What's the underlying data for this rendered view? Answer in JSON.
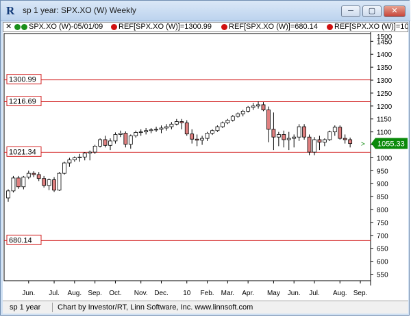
{
  "window": {
    "title": "sp 1 year: SPX.XO (W) Weekly",
    "app_icon": "investor-rt-icon",
    "buttons": {
      "minimize": "─",
      "maximize": "▢",
      "close": "✕"
    }
  },
  "legend": {
    "close_glyph": "✕",
    "items": [
      {
        "label": "SPX.XO (W)-05/01/09",
        "dot_color": "#1a8f1a",
        "dot_color2": "#1a8f1a"
      },
      {
        "label": "REF[SPX.XO (W)]=1300.99",
        "dot_color": "#d01010"
      },
      {
        "label": "REF[SPX.XO (W)]=680.14",
        "dot_color": "#d01010"
      },
      {
        "label": "REF[SPX.XO (W)]=10",
        "dot_color": "#d01010"
      }
    ]
  },
  "status": {
    "left": "sp 1 year",
    "right": "Chart by Investor/RT, Linn Software, Inc. www.linnsoft.com"
  },
  "chart_data": {
    "type": "candlestick",
    "symbol": "SPX.XO (W) Weekly",
    "ylim": [
      525,
      1480
    ],
    "y_ticks": [
      550,
      600,
      650,
      700,
      750,
      800,
      850,
      900,
      950,
      1000,
      1050,
      1100,
      1150,
      1200,
      1250,
      1300,
      1350,
      1400,
      1450
    ],
    "extra_tick": "1500",
    "x_labels": [
      "Jun.",
      "Jul.",
      "Aug.",
      "Sep.",
      "Oct.",
      "Nov.",
      "Dec.",
      "10",
      "Feb.",
      "Mar.",
      "Apr.",
      "May",
      "Jun.",
      "Jul.",
      "Aug.",
      "Sep."
    ],
    "x_label_weeks": [
      4,
      9,
      13,
      17,
      21,
      26,
      30,
      35,
      39,
      43,
      47,
      52,
      56,
      60,
      65,
      69
    ],
    "ref_lines": [
      {
        "label": "1300.99",
        "value": 1300.99,
        "color": "#d22020"
      },
      {
        "label": "1216.69",
        "value": 1216.69,
        "color": "#d22020"
      },
      {
        "label": "1021.34",
        "value": 1021.34,
        "color": "#d22020"
      },
      {
        "label": "680.14",
        "value": 680.14,
        "color": "#d22020"
      }
    ],
    "last_price": {
      "label": "1055.33",
      "value": 1055.33,
      "color": "#0b8a0b"
    },
    "up_color": "#ffffff",
    "down_color": "#e08080",
    "candles": [
      {
        "o": 845,
        "h": 878,
        "l": 830,
        "c": 872
      },
      {
        "o": 872,
        "h": 930,
        "l": 866,
        "c": 922
      },
      {
        "o": 922,
        "h": 930,
        "l": 880,
        "c": 888
      },
      {
        "o": 888,
        "h": 930,
        "l": 878,
        "c": 925
      },
      {
        "o": 925,
        "h": 950,
        "l": 918,
        "c": 940
      },
      {
        "o": 940,
        "h": 948,
        "l": 925,
        "c": 935
      },
      {
        "o": 935,
        "h": 945,
        "l": 910,
        "c": 920
      },
      {
        "o": 920,
        "h": 930,
        "l": 885,
        "c": 893
      },
      {
        "o": 893,
        "h": 920,
        "l": 875,
        "c": 915
      },
      {
        "o": 915,
        "h": 925,
        "l": 868,
        "c": 875
      },
      {
        "o": 875,
        "h": 945,
        "l": 872,
        "c": 940
      },
      {
        "o": 940,
        "h": 985,
        "l": 935,
        "c": 980
      },
      {
        "o": 980,
        "h": 1000,
        "l": 965,
        "c": 992
      },
      {
        "o": 992,
        "h": 1005,
        "l": 985,
        "c": 1000
      },
      {
        "o": 1000,
        "h": 1015,
        "l": 985,
        "c": 1003
      },
      {
        "o": 1003,
        "h": 1022,
        "l": 990,
        "c": 1018
      },
      {
        "o": 1018,
        "h": 1028,
        "l": 990,
        "c": 1022
      },
      {
        "o": 1022,
        "h": 1050,
        "l": 1015,
        "c": 1045
      },
      {
        "o": 1045,
        "h": 1075,
        "l": 1040,
        "c": 1070
      },
      {
        "o": 1070,
        "h": 1085,
        "l": 1040,
        "c": 1048
      },
      {
        "o": 1048,
        "h": 1075,
        "l": 1030,
        "c": 1065
      },
      {
        "o": 1065,
        "h": 1098,
        "l": 1055,
        "c": 1090
      },
      {
        "o": 1090,
        "h": 1105,
        "l": 1080,
        "c": 1095
      },
      {
        "o": 1095,
        "h": 1102,
        "l": 1040,
        "c": 1052
      },
      {
        "o": 1052,
        "h": 1090,
        "l": 1035,
        "c": 1085
      },
      {
        "o": 1085,
        "h": 1105,
        "l": 1078,
        "c": 1098
      },
      {
        "o": 1098,
        "h": 1110,
        "l": 1085,
        "c": 1100
      },
      {
        "o": 1100,
        "h": 1115,
        "l": 1090,
        "c": 1105
      },
      {
        "o": 1105,
        "h": 1115,
        "l": 1095,
        "c": 1108
      },
      {
        "o": 1108,
        "h": 1120,
        "l": 1100,
        "c": 1110
      },
      {
        "o": 1110,
        "h": 1125,
        "l": 1095,
        "c": 1115
      },
      {
        "o": 1115,
        "h": 1130,
        "l": 1105,
        "c": 1120
      },
      {
        "o": 1120,
        "h": 1138,
        "l": 1110,
        "c": 1130
      },
      {
        "o": 1130,
        "h": 1150,
        "l": 1125,
        "c": 1140
      },
      {
        "o": 1140,
        "h": 1150,
        "l": 1110,
        "c": 1135
      },
      {
        "o": 1135,
        "h": 1145,
        "l": 1085,
        "c": 1092
      },
      {
        "o": 1092,
        "h": 1110,
        "l": 1055,
        "c": 1072
      },
      {
        "o": 1072,
        "h": 1090,
        "l": 1045,
        "c": 1068
      },
      {
        "o": 1068,
        "h": 1085,
        "l": 1050,
        "c": 1075
      },
      {
        "o": 1075,
        "h": 1100,
        "l": 1065,
        "c": 1095
      },
      {
        "o": 1095,
        "h": 1110,
        "l": 1088,
        "c": 1105
      },
      {
        "o": 1105,
        "h": 1125,
        "l": 1100,
        "c": 1120
      },
      {
        "o": 1120,
        "h": 1140,
        "l": 1115,
        "c": 1135
      },
      {
        "o": 1135,
        "h": 1150,
        "l": 1130,
        "c": 1145
      },
      {
        "o": 1145,
        "h": 1165,
        "l": 1140,
        "c": 1160
      },
      {
        "o": 1160,
        "h": 1175,
        "l": 1155,
        "c": 1170
      },
      {
        "o": 1170,
        "h": 1185,
        "l": 1160,
        "c": 1180
      },
      {
        "o": 1180,
        "h": 1200,
        "l": 1175,
        "c": 1195
      },
      {
        "o": 1195,
        "h": 1212,
        "l": 1185,
        "c": 1200
      },
      {
        "o": 1200,
        "h": 1218,
        "l": 1190,
        "c": 1205
      },
      {
        "o": 1205,
        "h": 1215,
        "l": 1180,
        "c": 1185
      },
      {
        "o": 1185,
        "h": 1198,
        "l": 1060,
        "c": 1110
      },
      {
        "o": 1110,
        "h": 1175,
        "l": 1030,
        "c": 1080
      },
      {
        "o": 1080,
        "h": 1100,
        "l": 1045,
        "c": 1090
      },
      {
        "o": 1090,
        "h": 1105,
        "l": 1040,
        "c": 1070
      },
      {
        "o": 1070,
        "h": 1100,
        "l": 1030,
        "c": 1075
      },
      {
        "o": 1075,
        "h": 1090,
        "l": 1040,
        "c": 1080
      },
      {
        "o": 1080,
        "h": 1130,
        "l": 1065,
        "c": 1120
      },
      {
        "o": 1120,
        "h": 1130,
        "l": 1070,
        "c": 1080
      },
      {
        "o": 1080,
        "h": 1090,
        "l": 1010,
        "c": 1022
      },
      {
        "o": 1022,
        "h": 1080,
        "l": 1010,
        "c": 1070
      },
      {
        "o": 1070,
        "h": 1085,
        "l": 1030,
        "c": 1060
      },
      {
        "o": 1060,
        "h": 1075,
        "l": 1045,
        "c": 1070
      },
      {
        "o": 1070,
        "h": 1105,
        "l": 1065,
        "c": 1100
      },
      {
        "o": 1100,
        "h": 1125,
        "l": 1085,
        "c": 1118
      },
      {
        "o": 1118,
        "h": 1125,
        "l": 1070,
        "c": 1075
      },
      {
        "o": 1075,
        "h": 1090,
        "l": 1055,
        "c": 1070
      },
      {
        "o": 1070,
        "h": 1078,
        "l": 1040,
        "c": 1055
      }
    ]
  }
}
